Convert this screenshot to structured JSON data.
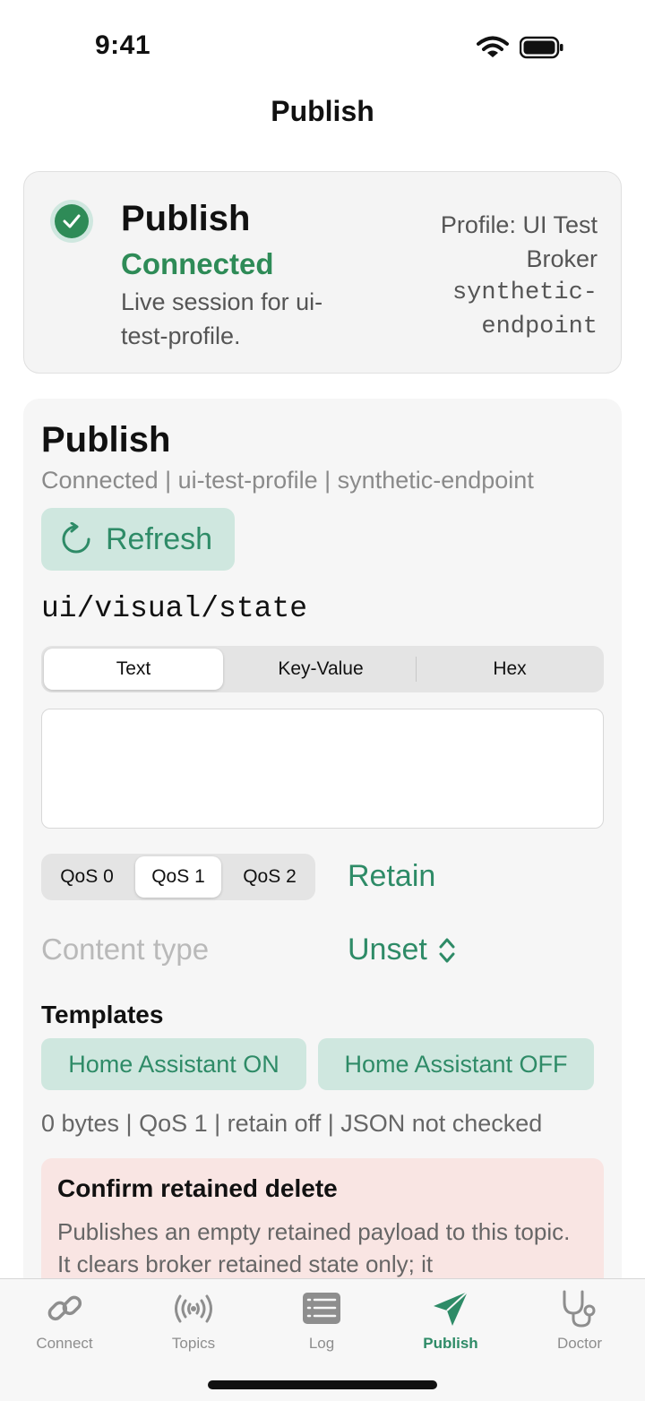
{
  "status_bar": {
    "time": "9:41"
  },
  "nav": {
    "title": "Publish"
  },
  "connection_card": {
    "title": "Publish",
    "status": "Connected",
    "description": "Live session for ui-test-profile.",
    "profile": "Profile: UI Test Broker",
    "endpoint": "synthetic-endpoint",
    "status_color": "#2e8b57"
  },
  "panel": {
    "title": "Publish",
    "subtitle": "Connected | ui-test-profile | synthetic-endpoint",
    "refresh_label": "Refresh",
    "topic": "ui/visual/state",
    "format_tabs": [
      "Text",
      "Key-Value",
      "Hex"
    ],
    "format_selected": "Text",
    "payload_value": "",
    "qos_options": [
      "QoS 0",
      "QoS 1",
      "QoS 2"
    ],
    "qos_selected": "QoS 1",
    "retain_label": "Retain",
    "content_type_label": "Content type",
    "content_type_value": "Unset",
    "templates_heading": "Templates",
    "templates": [
      "Home Assistant ON",
      "Home Assistant OFF"
    ],
    "summary": "0 bytes | QoS 1 | retain off | JSON not checked",
    "warning": {
      "title": "Confirm retained delete",
      "body": "Publishes an empty retained payload to this topic. It clears broker retained state only; it"
    }
  },
  "tab_bar": {
    "items": [
      {
        "label": "Connect",
        "icon": "link-icon"
      },
      {
        "label": "Topics",
        "icon": "broadcast-icon"
      },
      {
        "label": "Log",
        "icon": "list-icon"
      },
      {
        "label": "Publish",
        "icon": "paperplane-icon"
      },
      {
        "label": "Doctor",
        "icon": "stethoscope-icon"
      }
    ],
    "active": "Publish"
  },
  "colors": {
    "accent": "#2e8b67",
    "accent_bg": "#cfe7df",
    "warning_bg": "#f9e5e3"
  }
}
